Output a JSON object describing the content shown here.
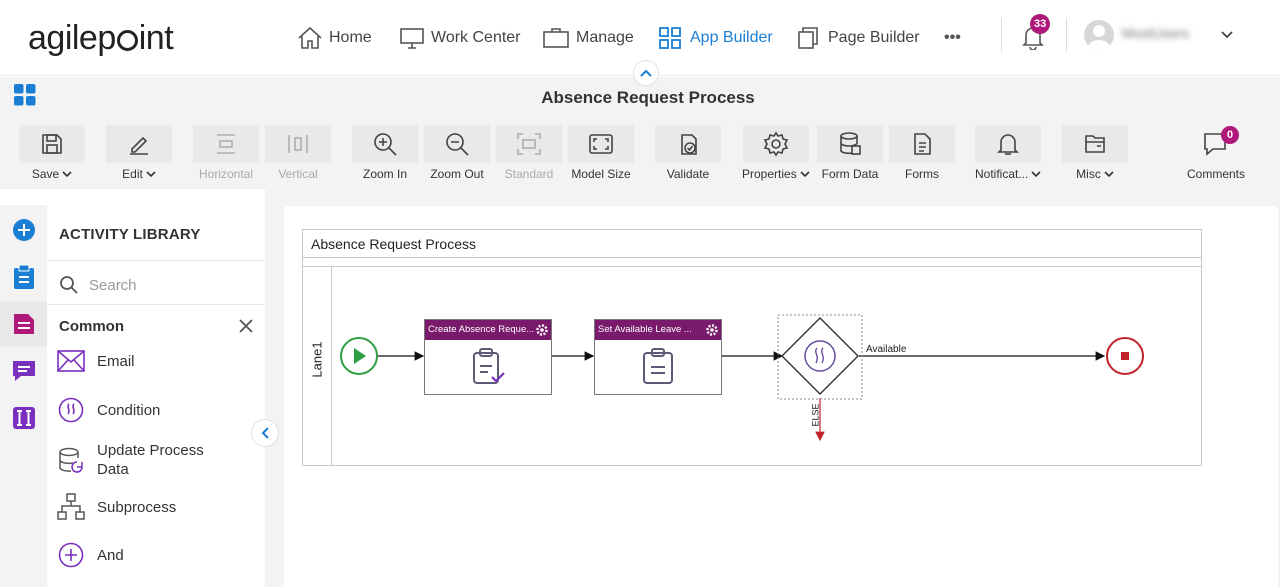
{
  "brand": {
    "logo_before": "agilep",
    "logo_after": "int"
  },
  "nav": {
    "home": "Home",
    "work_center": "Work Center",
    "manage": "Manage",
    "app_builder": "App Builder",
    "page_builder": "Page Builder",
    "more": "•••",
    "notifications_count": "33",
    "username": "MostUsers"
  },
  "page": {
    "title": "Absence Request Process"
  },
  "toolbar": {
    "save": "Save",
    "edit": "Edit",
    "horizontal": "Horizontal",
    "vertical": "Vertical",
    "zoom_in": "Zoom In",
    "zoom_out": "Zoom Out",
    "standard": "Standard",
    "model_size": "Model Size",
    "validate": "Validate",
    "properties": "Properties",
    "form_data": "Form Data",
    "forms": "Forms",
    "notifications": "Notificat...",
    "misc": "Misc",
    "comments": "Comments",
    "comments_count": "0"
  },
  "library": {
    "title": "ACTIVITY LIBRARY",
    "search_placeholder": "Search",
    "group": "Common",
    "items": [
      {
        "label": "Email",
        "icon": "envelope-icon"
      },
      {
        "label": "Condition",
        "icon": "condition-icon"
      },
      {
        "label": "Update Process Data",
        "icon": "update-data-icon"
      },
      {
        "label": "Subprocess",
        "icon": "subprocess-icon"
      },
      {
        "label": "And",
        "icon": "and-plus-icon"
      }
    ]
  },
  "diagram": {
    "pool_title": "Absence Request Process",
    "lane": "Lane1",
    "tasks": [
      {
        "title": "Create Absence Reque...",
        "icon": "form-check-icon"
      },
      {
        "title": "Set Available Leave ...",
        "icon": "form-icon"
      }
    ],
    "gateway_icon": "condition-icon",
    "flow_available": "Available",
    "flow_else": "ELSE"
  },
  "colors": {
    "accent": "#1a7fd4",
    "brand_purple": "#7a1a6c",
    "badge": "#b0197a",
    "start": "#2e9e44",
    "end": "#c0222a"
  }
}
